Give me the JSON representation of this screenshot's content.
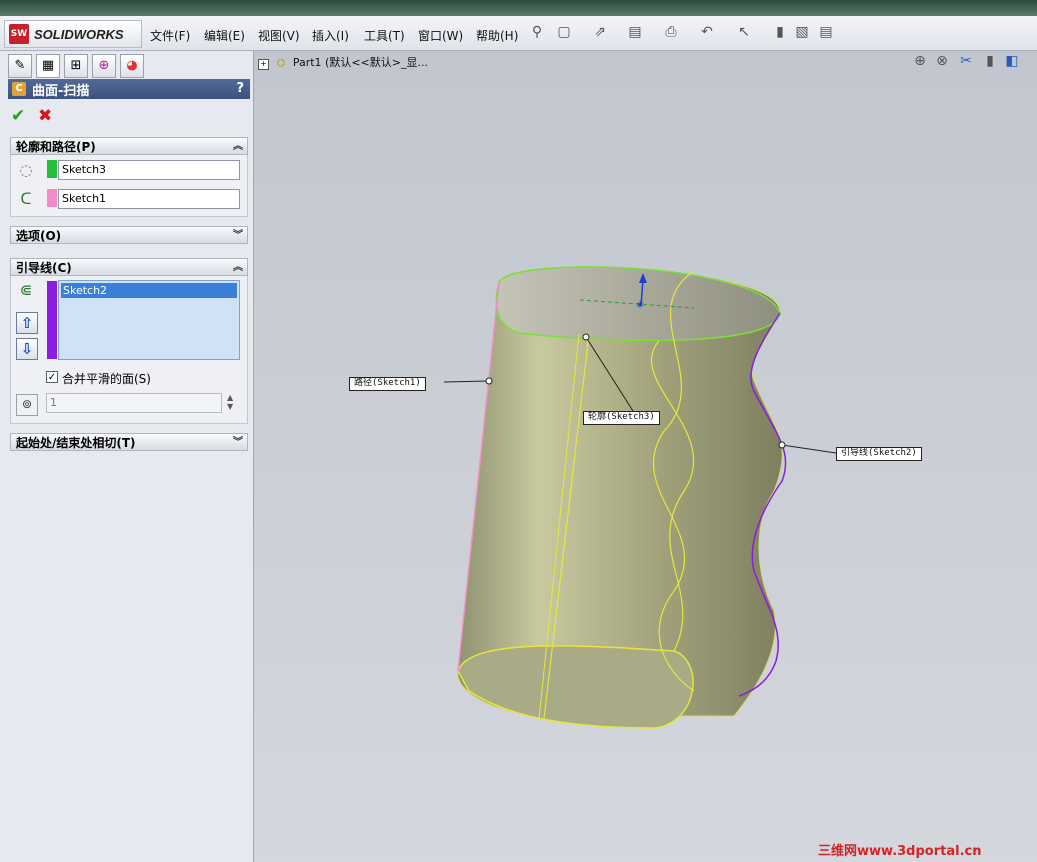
{
  "app": {
    "logo_mark": "SW",
    "logo_text": "SOLIDWORKS"
  },
  "menu": [
    "文件(F)",
    "编辑(E)",
    "视图(V)",
    "插入(I)",
    "工具(T)",
    "窗口(W)",
    "帮助(H)"
  ],
  "feature": {
    "title": "曲面-扫描",
    "help": "?"
  },
  "groups": {
    "profile_path": {
      "title": "轮廓和路径(P)",
      "profile": "Sketch3",
      "path": "Sketch1",
      "profile_color": "#22c03a",
      "path_color": "#f28cc4"
    },
    "options": {
      "title": "选项(O)"
    },
    "guides": {
      "title": "引导线(C)",
      "selected": "Sketch2",
      "color": "#8a1de0",
      "merge_label": "合并平滑的面(S)",
      "merge_checked": "✓",
      "stepper_value": "1"
    },
    "tangency": {
      "title": "起始处/结束处相切(T)"
    }
  },
  "tree": {
    "expander": "+",
    "label": "Part1  (默认<<默认>_显..."
  },
  "callouts": {
    "path": "路径(Sketch1)",
    "profile": "轮廓(Sketch3)",
    "guide": "引导线(Sketch2)"
  },
  "watermark": "三维网www.3dportal.cn"
}
